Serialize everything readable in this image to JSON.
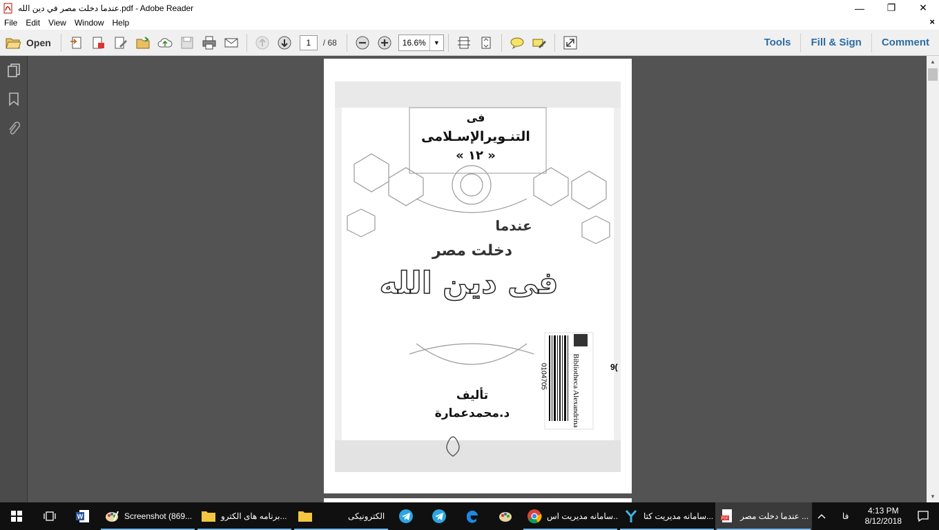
{
  "window": {
    "title": "عندما دخلت مصر في دين الله.pdf - Adobe Reader",
    "minimize_symbol": "—",
    "restore_symbol": "❐",
    "close_symbol": "✕"
  },
  "menu": {
    "items": [
      "File",
      "Edit",
      "View",
      "Window",
      "Help"
    ],
    "close_doc_symbol": "×"
  },
  "toolbar": {
    "open_label": "Open",
    "page_current": "1",
    "page_total": "/ 68",
    "zoom_value": "16.6%",
    "links": [
      "Tools",
      "Fill & Sign",
      "Comment"
    ]
  },
  "document": {
    "series_line1": "فى",
    "series_line2": "التنـويرالإسـلامى",
    "series_number": "« ١٢ »",
    "title_line1": "عندما",
    "title_line2": "دخلت مصر",
    "title_line3": "فى دين الله",
    "author_label": "تأليف",
    "author_name": "د.محمدعمارة",
    "library_stamp": "Bibliotheca Alexandrina",
    "barcode_number": "0104705",
    "side_mark": "9("
  },
  "taskbar": {
    "apps": [
      {
        "label": "Screenshot (869..."
      },
      {
        "label": "برنامه های الکترو..."
      },
      {
        "label": "الکترونیکی"
      },
      {
        "label": "سامانه مدیریت اس..."
      },
      {
        "label": "سامانه مدیریت کتا..."
      },
      {
        "label": "عندما دخلت مصر ..."
      }
    ],
    "lang": "فا",
    "time": "4:13 PM",
    "date": "8/12/2018"
  },
  "colors": {
    "link_blue": "#2b6ca3",
    "doc_bg": "#535353",
    "taskbar_bg": "#101010"
  }
}
